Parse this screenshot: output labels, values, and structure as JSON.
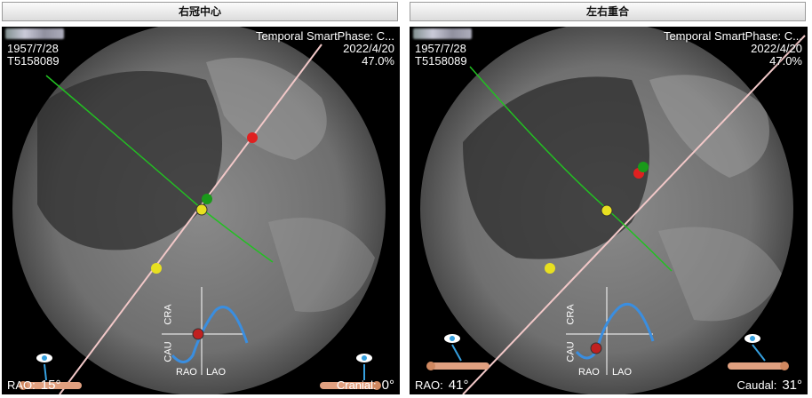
{
  "panels": [
    {
      "title": "右冠中心",
      "patient_blur": "",
      "birth_date": "1957/7/28",
      "patient_id": "T5158089",
      "study_title": "Temporal SmartPhase: C...",
      "study_date": "2022/4/20",
      "zoom": "47.0%",
      "angle_left_label": "RAO:",
      "angle_left_value": "15°",
      "angle_right_label": "Cranial:",
      "angle_right_value": "0°",
      "curve_labels": {
        "cra": "CRA",
        "cau": "CAU",
        "rao": "RAO",
        "lao": "LAO"
      }
    },
    {
      "title": "左右重合",
      "patient_blur": "",
      "birth_date": "1957/7/28",
      "patient_id": "T5158089",
      "study_title": "Temporal SmartPhase: C...",
      "study_date": "2022/4/20",
      "zoom": "47.0%",
      "angle_left_label": "RAO:",
      "angle_left_value": "41°",
      "angle_right_label": "Caudal:",
      "angle_right_value": "31°",
      "curve_labels": {
        "cra": "CRA",
        "cau": "CAU",
        "rao": "RAO",
        "lao": "LAO"
      }
    }
  ],
  "colors": {
    "green_line": "#22c022",
    "pink_line": "#f2c8c8",
    "yellow_dot": "#e8e020",
    "red_dot": "#e02020",
    "green_dot": "#1a9a1a",
    "eye_icon": "#35a0e0",
    "curve": "#3a8ee0"
  }
}
